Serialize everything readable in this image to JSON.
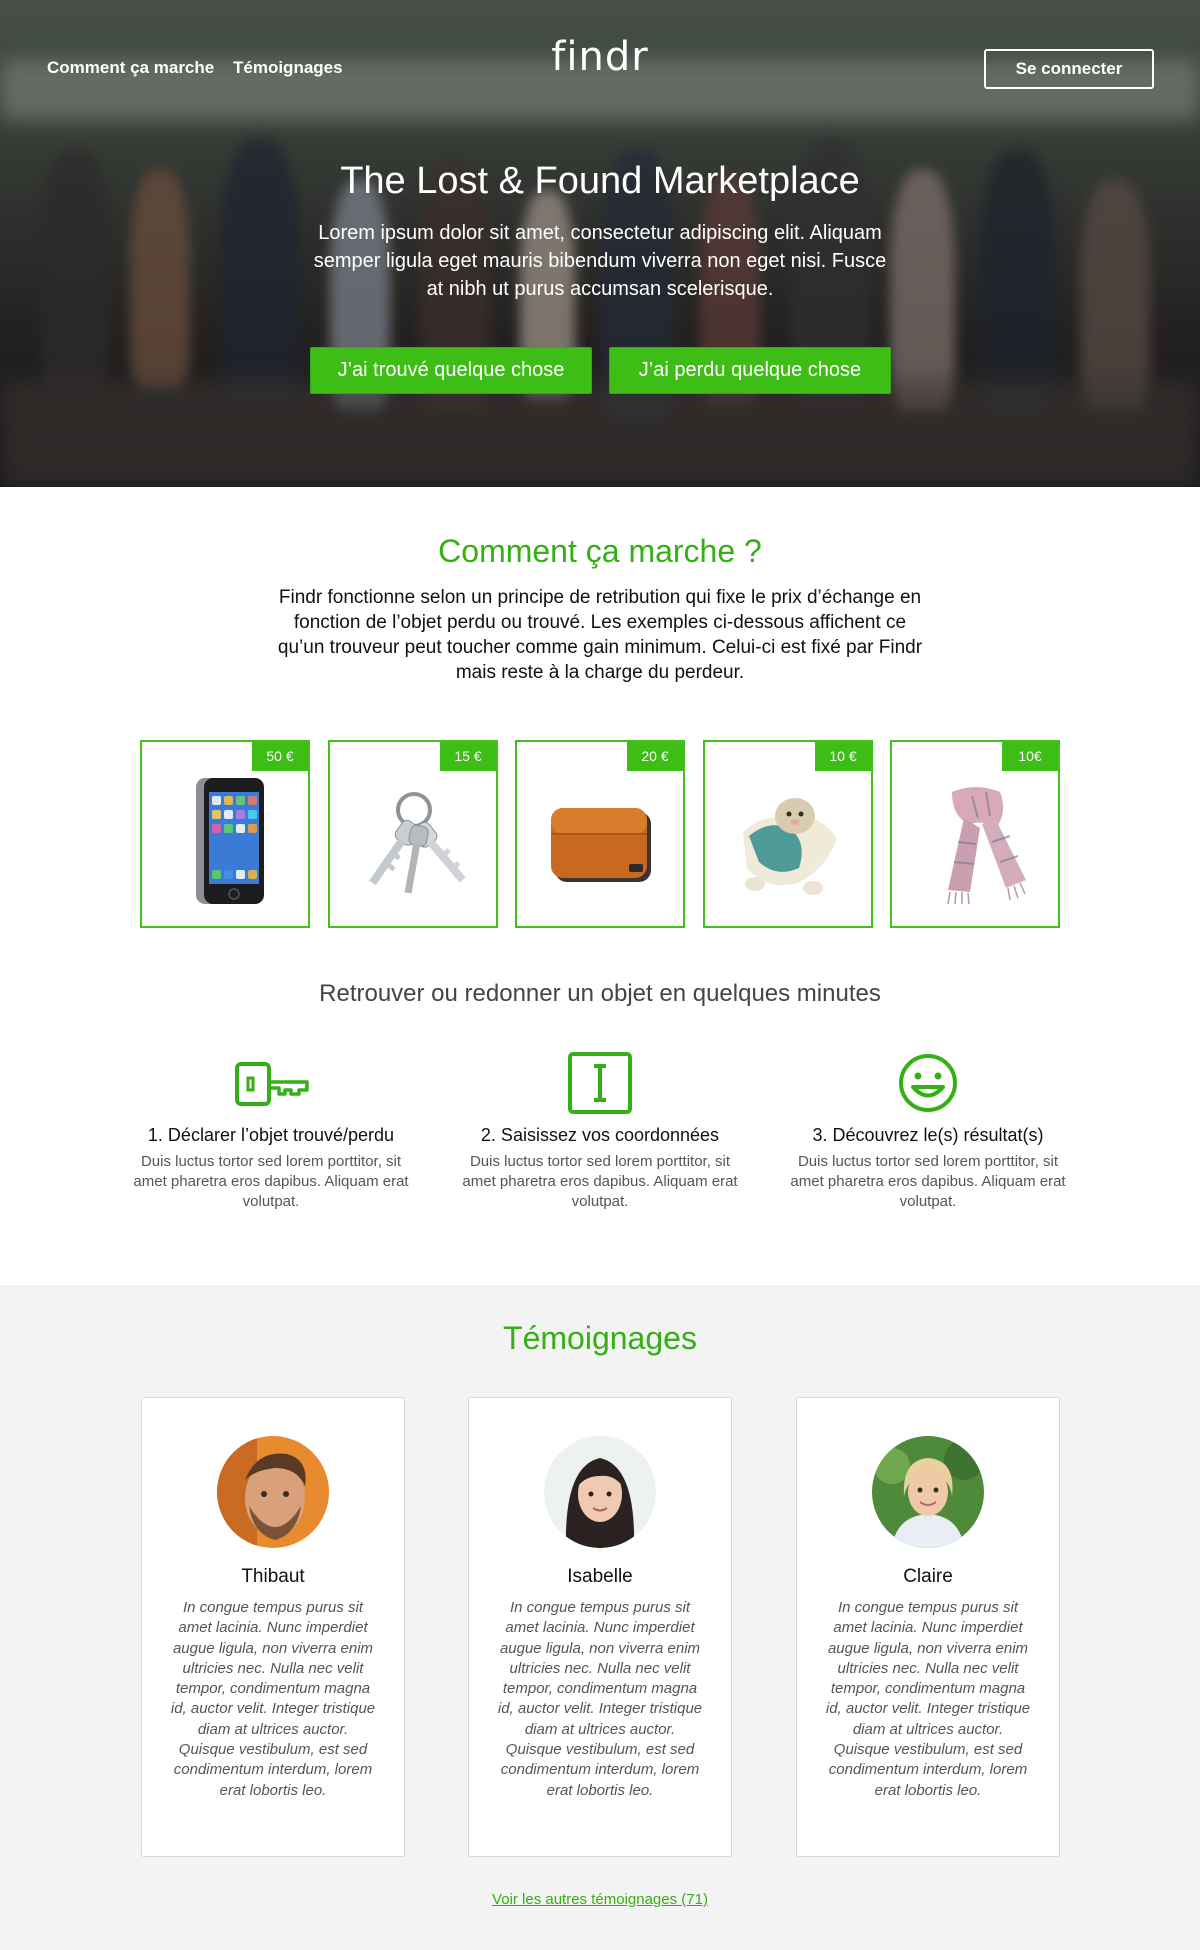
{
  "nav": {
    "how_it_works": "Comment ça marche",
    "testimonials": "Témoignages",
    "logo": "findr",
    "login": "Se connecter"
  },
  "hero": {
    "title": "The Lost & Found Marketplace",
    "subtitle": "Lorem ipsum dolor sit amet, consectetur adipiscing elit. Aliquam semper ligula eget mauris bibendum viverra non eget nisi. Fusce at nibh ut purus accumsan scelerisque.",
    "cta_found": "J’ai trouvé quelque chose",
    "cta_lost": "J’ai perdu quelque chose"
  },
  "how": {
    "title": "Comment ça marche ?",
    "intro": "Findr fonctionne selon un principe de retribution qui fixe le prix d’échange en fonction de l’objet perdu ou trouvé. Les exemples ci-dessous affichent ce qu’un trouveur peut toucher comme gain minimum. Celui-ci est fixé par Findr mais reste à la charge du perdeur.",
    "items": [
      {
        "price": "50 €",
        "icon": "smartphone-icon"
      },
      {
        "price": "15 €",
        "icon": "keys-icon"
      },
      {
        "price": "20 €",
        "icon": "wallet-icon"
      },
      {
        "price": "10 €",
        "icon": "plush-toy-icon"
      },
      {
        "price": "10€",
        "icon": "scarf-icon"
      }
    ],
    "subheading": "Retrouver ou redonner un objet en quelques minutes",
    "steps": [
      {
        "icon": "key-icon",
        "title": "1. Déclarer l’objet trouvé/perdu",
        "desc": "Duis luctus tortor sed lorem porttitor, sit amet pharetra eros dapibus. Aliquam erat volutpat."
      },
      {
        "icon": "id-card-icon",
        "title": "2. Saisissez vos coordonnées",
        "desc": "Duis luctus tortor sed lorem porttitor, sit amet pharetra eros dapibus. Aliquam erat volutpat."
      },
      {
        "icon": "smiley-icon",
        "title": "3. Découvrez le(s) résultat(s)",
        "desc": "Duis luctus tortor sed lorem porttitor, sit amet pharetra eros dapibus. Aliquam erat volutpat."
      }
    ]
  },
  "testimonials": {
    "title": "Témoignages",
    "items": [
      {
        "name": "Thibaut",
        "text": "In congue tempus purus sit amet lacinia. Nunc imperdiet augue ligula, non viverra enim ultricies nec. Nulla nec velit tempor, condimentum magna id, auctor velit. Integer tristique diam at ultrices auctor. Quisque vestibulum, est sed condimentum interdum, lorem erat lobortis leo."
      },
      {
        "name": "Isabelle",
        "text": "In congue tempus purus sit amet lacinia. Nunc imperdiet augue ligula, non viverra enim ultricies nec. Nulla nec velit tempor, condimentum magna id, auctor velit. Integer tristique diam at ultrices auctor. Quisque vestibulum, est sed condimentum interdum, lorem erat lobortis leo."
      },
      {
        "name": "Claire",
        "text": "In congue tempus purus sit amet lacinia. Nunc imperdiet augue ligula, non viverra enim ultricies nec. Nulla nec velit tempor, condimentum magna id, auctor velit. Integer tristique diam at ultrices auctor. Quisque vestibulum, est sed condimentum interdum, lorem erat lobortis leo."
      }
    ],
    "more_link": "Voir les autres témoignages (71)"
  },
  "colors": {
    "accent": "#3dbd16",
    "accent_text": "#35b014",
    "testimonial_bg": "#f3f3f3"
  }
}
